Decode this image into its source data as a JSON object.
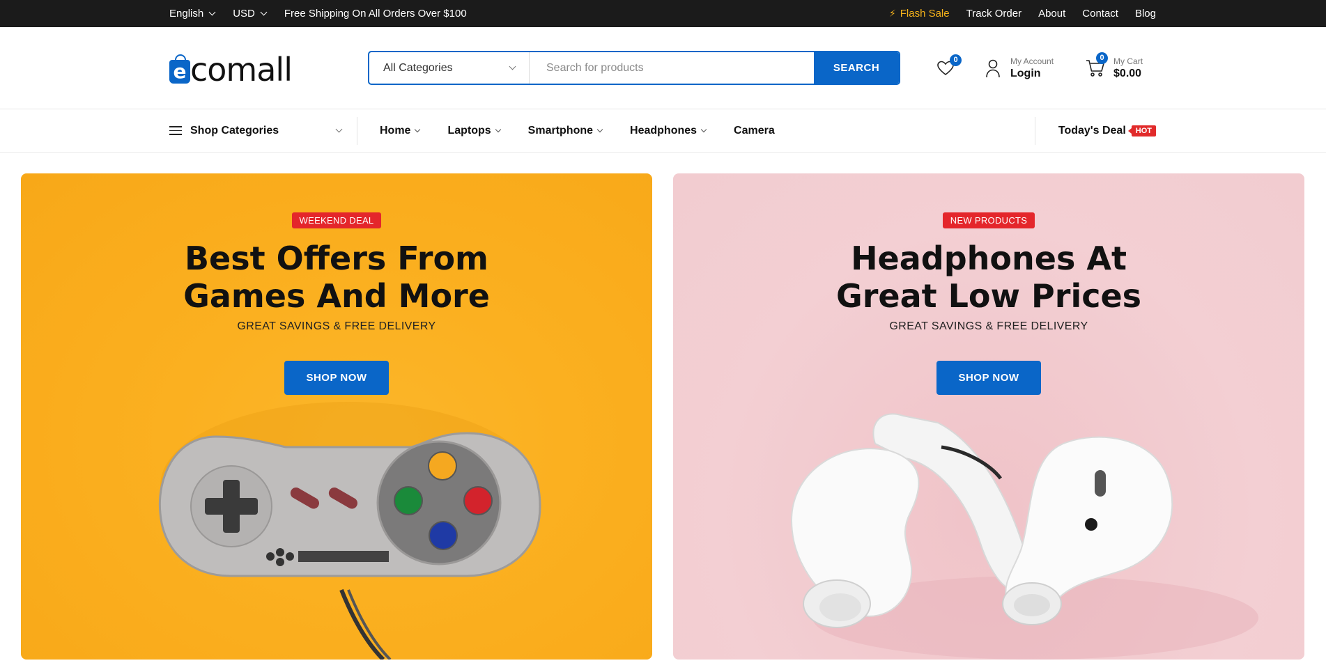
{
  "topbar": {
    "language": "English",
    "currency": "USD",
    "promo": "Free Shipping On All Orders Over $100",
    "links": [
      "Flash Sale",
      "Track Order",
      "About",
      "Contact",
      "Blog"
    ]
  },
  "header": {
    "logo": "comall",
    "logo_letter": "e",
    "search": {
      "category": "All Categories",
      "placeholder": "Search for products",
      "button": "SEARCH"
    },
    "wishlist_count": "0",
    "account": {
      "label": "My Account",
      "action": "Login"
    },
    "cart": {
      "label": "My Cart",
      "total": "$0.00",
      "count": "0"
    }
  },
  "nav": {
    "shop_categories": "Shop Categories",
    "items": [
      "Home",
      "Laptops",
      "Smartphone",
      "Headphones",
      "Camera"
    ],
    "deal": "Today's Deal",
    "deal_badge": "HOT"
  },
  "banners": [
    {
      "tag": "WEEKEND DEAL",
      "title_line1": "Best Offers From",
      "title_line2": "Games And More",
      "subtitle": "GREAT SAVINGS & FREE DELIVERY",
      "button": "SHOP NOW"
    },
    {
      "tag": "NEW PRODUCTS",
      "title_line1": "Headphones At",
      "title_line2": "Great Low Prices",
      "subtitle": "GREAT SAVINGS & FREE DELIVERY",
      "button": "SHOP NOW"
    }
  ],
  "colors": {
    "brand": "#0a66c8",
    "flash": "#f5b21b",
    "tag": "#e4262b",
    "banner_games": "#fbb020",
    "banner_phones": "#f2ccd0"
  }
}
